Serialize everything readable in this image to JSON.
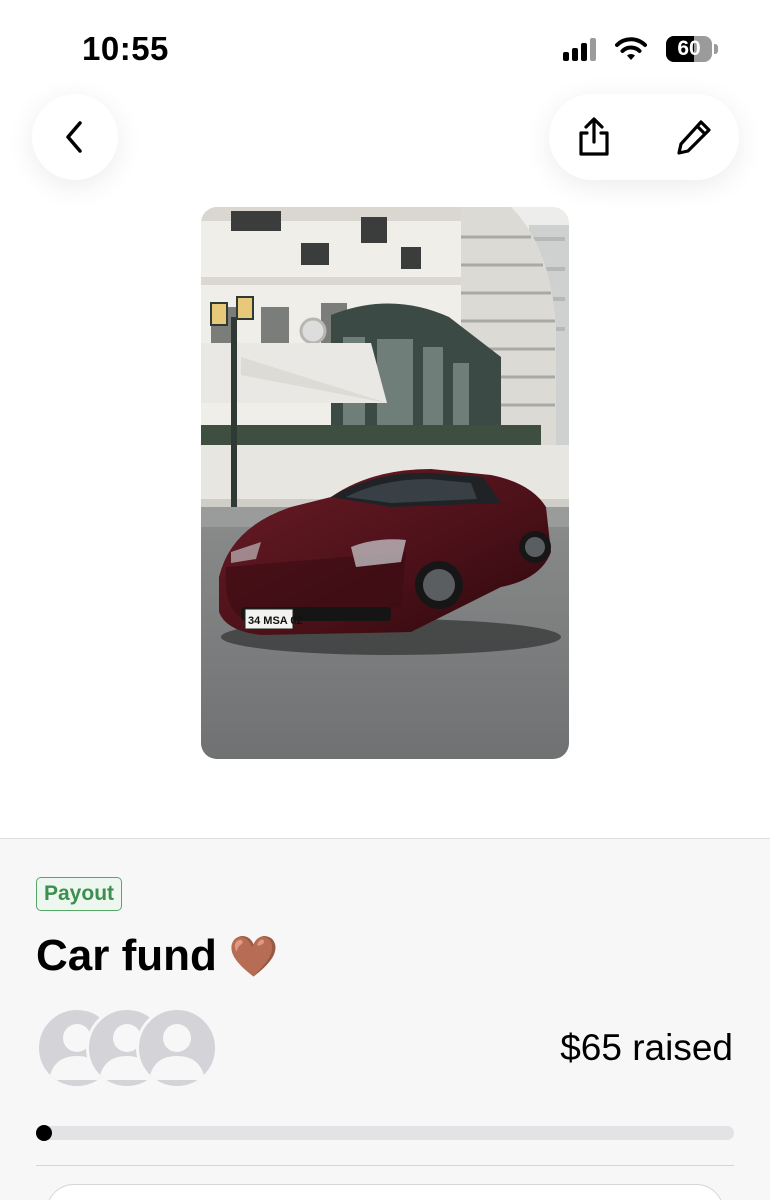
{
  "status_bar": {
    "time": "10:55",
    "battery": "60",
    "battery_level": 0.6,
    "icons": [
      "cellular-signal-icon",
      "wifi-icon",
      "battery-icon"
    ]
  },
  "nav": {
    "icons": [
      "chevron-left-icon",
      "share-icon",
      "pencil-icon"
    ]
  },
  "fund": {
    "badge": "Payout",
    "title": "Car fund",
    "emoji": "🤎",
    "raised": "$65 raised",
    "progress": 0.005
  },
  "colors": {
    "badge_green": "#3d8f4f",
    "sheet_bg": "#f7f7f7",
    "progress_fill": "#000000",
    "progress_track": "#e3e3e6",
    "car_body": "#4a1018"
  }
}
